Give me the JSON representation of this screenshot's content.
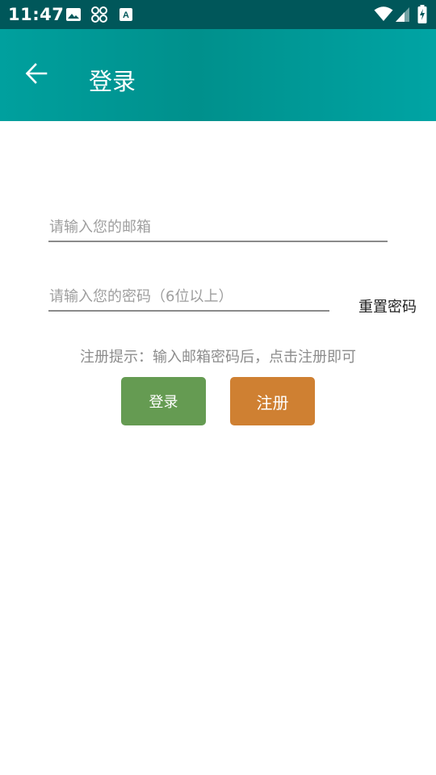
{
  "status_bar": {
    "time": "11:47",
    "icons_left": [
      "image-icon",
      "grid-icon",
      "accessibility-text-icon"
    ],
    "icons_right": [
      "wifi-icon",
      "cellular-signal-icon",
      "battery-charging-icon"
    ]
  },
  "app_bar": {
    "title": "登录",
    "back_icon": "arrow-left-icon",
    "colors": {
      "background": "#009e9b",
      "status_bar": "#00575a"
    }
  },
  "form": {
    "email_placeholder": "请输入您的邮箱",
    "email_value": "",
    "password_placeholder": "请输入您的密码（6位以上）",
    "password_value": "",
    "reset_password_label": "重置密码",
    "hint": "注册提示：输入邮箱密码后，点击注册即可"
  },
  "buttons": {
    "login_label": "登录",
    "register_label": "注册",
    "login_color": "#659b52",
    "register_color": "#cf8032"
  }
}
